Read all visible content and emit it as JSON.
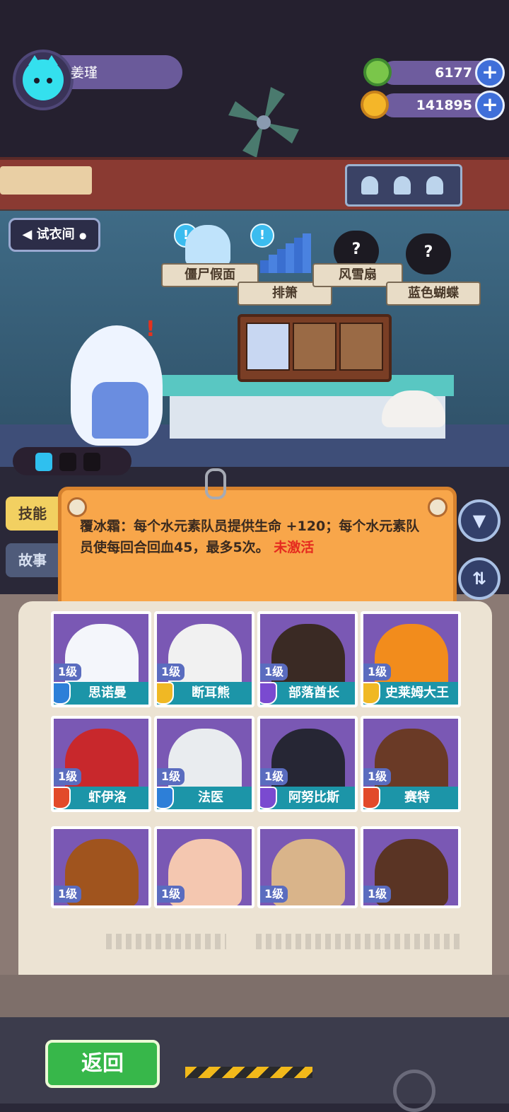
{
  "player": {
    "name": "姜瑾"
  },
  "currencies": [
    {
      "name": "gem",
      "value": "6177",
      "icon": "green-donut-icon",
      "color": "#7ac64a"
    },
    {
      "name": "coin",
      "value": "141895",
      "icon": "gold-planet-icon",
      "color": "#f4b629"
    }
  ],
  "scene": {
    "fitting_room_label": "试衣间",
    "items": [
      {
        "label": "僵尸假面",
        "status": "unlocked",
        "icon": "ice-crown-icon"
      },
      {
        "label": "排箫",
        "status": "unlocked",
        "icon": "panpipe-icon"
      },
      {
        "label": "风雪扇",
        "status": "locked",
        "icon": "mystery-icon",
        "q": "?"
      },
      {
        "label": "蓝色蝴蝶",
        "status": "locked",
        "icon": "mystery-icon",
        "q": "?"
      }
    ],
    "hint_mark": "!"
  },
  "tabs": {
    "skill": "技能",
    "story": "故事"
  },
  "skill": {
    "text": "覆冰霜：每个水元素队员提供生命 +120；每个水元素队员使每回合回血45，最多5次。",
    "status": "未激活"
  },
  "cards": [
    {
      "name": "思诺曼",
      "level": "1级",
      "badge_color": "#2d7fd8",
      "face_color": "#f4f6fb"
    },
    {
      "name": "断耳熊",
      "level": "1级",
      "badge_color": "#f0b824",
      "face_color": "#f1f1f1"
    },
    {
      "name": "部落酋长",
      "level": "1级",
      "badge_color": "#7a4ad0",
      "face_color": "#3a2a24"
    },
    {
      "name": "史莱姆大王",
      "level": "1级",
      "badge_color": "#f0b824",
      "face_color": "#f28c1c"
    },
    {
      "name": "虾伊洛",
      "level": "1级",
      "badge_color": "#e24a2a",
      "face_color": "#c8282c"
    },
    {
      "name": "法医",
      "level": "1级",
      "badge_color": "#2d7fd8",
      "face_color": "#e9ecef"
    },
    {
      "name": "阿努比斯",
      "level": "1级",
      "badge_color": "#7a4ad0",
      "face_color": "#262634"
    },
    {
      "name": "赛特",
      "level": "1级",
      "badge_color": "#e24a2a",
      "face_color": "#6a3a26"
    },
    {
      "name": "",
      "level": "1级",
      "face_color": "#a0541e"
    },
    {
      "name": "",
      "level": "1级",
      "face_color": "#f4c7b0"
    },
    {
      "name": "",
      "level": "1级",
      "face_color": "#d9b48a"
    },
    {
      "name": "",
      "level": "1级",
      "face_color": "#5a3424"
    }
  ],
  "bottom": {
    "back_label": "返回"
  }
}
